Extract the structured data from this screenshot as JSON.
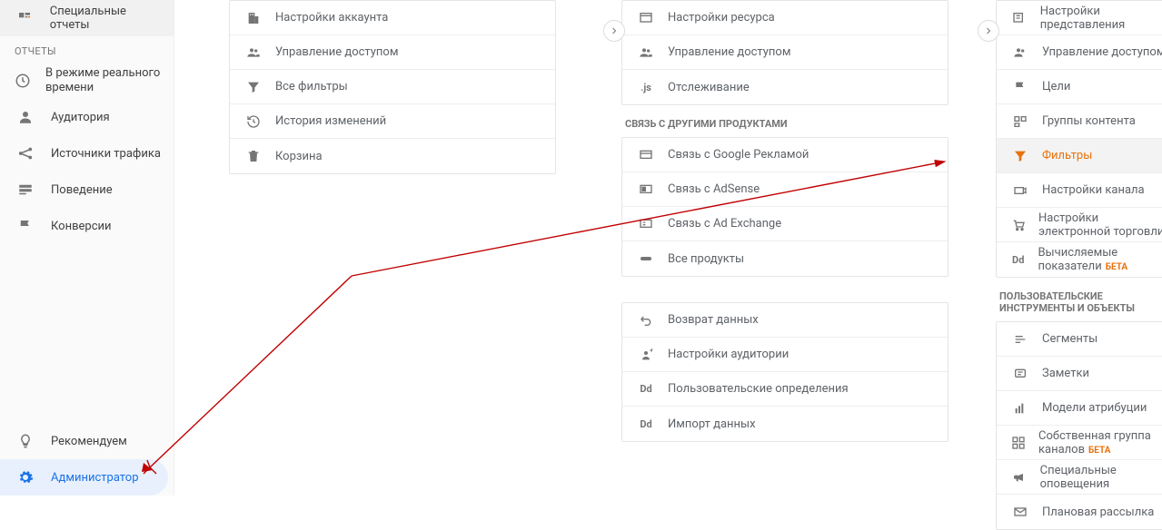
{
  "sidebar": {
    "top": [
      {
        "label": "Специальные отчеты"
      }
    ],
    "reports_header": "ОТЧЕТЫ",
    "reports": [
      {
        "label": "В режиме реального времени"
      },
      {
        "label": "Аудитория"
      },
      {
        "label": "Источники трафика"
      },
      {
        "label": "Поведение"
      },
      {
        "label": "Конверсии"
      }
    ],
    "bottom": [
      {
        "label": "Рекомендуем"
      },
      {
        "label": "Администратор"
      }
    ]
  },
  "account_col": [
    {
      "label": "Настройки аккаунта"
    },
    {
      "label": "Управление доступом"
    },
    {
      "label": "Все фильтры"
    },
    {
      "label": "История изменений"
    },
    {
      "label": "Корзина"
    }
  ],
  "property_col": {
    "main": [
      {
        "label": "Настройки ресурса"
      },
      {
        "label": "Управление доступом"
      },
      {
        "label": "Отслеживание"
      }
    ],
    "links_header": "СВЯЗЬ С ДРУГИМИ ПРОДУКТАМИ",
    "links": [
      {
        "label": "Связь с Google Рекламой"
      },
      {
        "label": "Связь с AdSense"
      },
      {
        "label": "Связь с Ad Exchange"
      },
      {
        "label": "Все продукты"
      }
    ],
    "misc": [
      {
        "label": "Возврат данных"
      },
      {
        "label": "Настройки аудитории"
      },
      {
        "label": "Пользовательские определения"
      },
      {
        "label": "Импорт данных"
      }
    ]
  },
  "view_col": {
    "main": [
      {
        "label": "Настройки представления"
      },
      {
        "label": "Управление доступом"
      },
      {
        "label": "Цели"
      },
      {
        "label": "Группы контента"
      },
      {
        "label": "Фильтры"
      },
      {
        "label": "Настройки канала"
      },
      {
        "label": "Настройки электронной торговли"
      },
      {
        "label": "Вычисляемые показатели",
        "beta": "БЕТА"
      }
    ],
    "tools_header": "ПОЛЬЗОВАТЕЛЬСКИЕ ИНСТРУМЕНТЫ И ОБЪЕКТЫ",
    "tools": [
      {
        "label": "Сегменты"
      },
      {
        "label": "Заметки"
      },
      {
        "label": "Модели атрибуции"
      },
      {
        "label": "Собственная группа каналов",
        "beta": "БЕТА"
      },
      {
        "label": "Специальные оповещения"
      },
      {
        "label": "Плановая рассылка"
      }
    ]
  }
}
